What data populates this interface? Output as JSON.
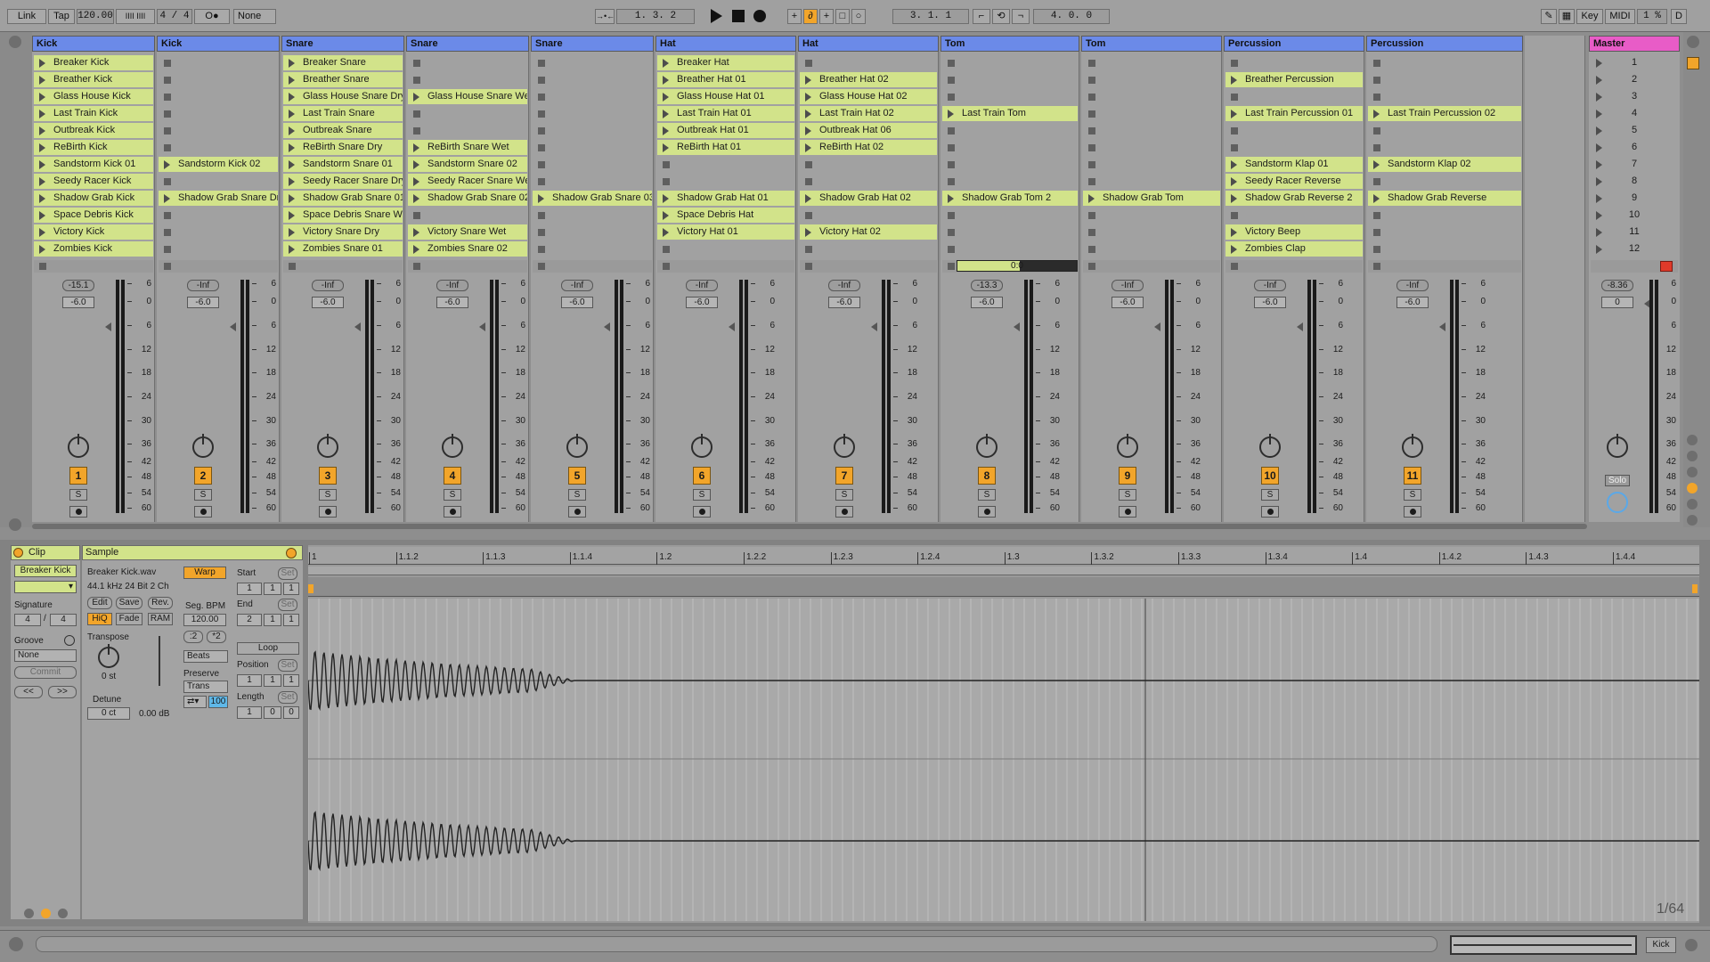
{
  "toolbar": {
    "link": "Link",
    "tap": "Tap",
    "tempo": "120.00",
    "bars_icons": "IIII IIII",
    "signature": "4 / 4",
    "metronome": "O●",
    "quantize": "None",
    "follow": "→•←",
    "position": "1.   3.   2",
    "loop_start": "3.   1.   1",
    "loop_length": "4.   0.   0",
    "key": "Key",
    "midi": "MIDI",
    "cpu": "1 %",
    "disk": "D"
  },
  "tracks": [
    {
      "name": "Kick",
      "color": "#6b8ae8",
      "number": "1",
      "vol": "-15.1",
      "set": "-6.0",
      "clips": [
        "Breaker Kick",
        "Breather Kick",
        "Glass House Kick",
        "Last Train Kick",
        "Outbreak Kick",
        "ReBirth Kick",
        "Sandstorm Kick 01",
        "Seedy Racer Kick",
        "Shadow Grab Kick",
        "Space Debris Kick",
        "Victory Kick",
        "Zombies Kick"
      ]
    },
    {
      "name": "Kick",
      "color": "#6b8ae8",
      "number": "2",
      "vol": "-Inf",
      "set": "-6.0",
      "clips": [
        "",
        "",
        "",
        "",
        "",
        "",
        "Sandstorm Kick 02",
        "",
        "Shadow Grab Snare Dry",
        "",
        "",
        ""
      ]
    },
    {
      "name": "Snare",
      "color": "#6b8ae8",
      "number": "3",
      "vol": "-Inf",
      "set": "-6.0",
      "clips": [
        "Breaker Snare",
        "Breather Snare",
        "Glass House Snare Dry",
        "Last Train Snare",
        "Outbreak Snare",
        "ReBirth Snare Dry",
        "Sandstorm Snare 01",
        "Seedy Racer Snare Dry",
        "Shadow Grab Snare 01",
        "Space Debris Snare We",
        "Victory Snare Dry",
        "Zombies Snare 01"
      ]
    },
    {
      "name": "Snare",
      "color": "#6b8ae8",
      "number": "4",
      "vol": "-Inf",
      "set": "-6.0",
      "clips": [
        "",
        "",
        "Glass House Snare Wet",
        "",
        "",
        "ReBirth Snare Wet",
        "Sandstorm Snare 02",
        "Seedy Racer Snare Wet",
        "Shadow Grab Snare 02",
        "",
        "Victory Snare Wet",
        "Zombies Snare 02"
      ]
    },
    {
      "name": "Snare",
      "color": "#6b8ae8",
      "number": "5",
      "vol": "-Inf",
      "set": "-6.0",
      "clips": [
        "",
        "",
        "",
        "",
        "",
        "",
        "",
        "",
        "Shadow Grab Snare 03",
        "",
        "",
        ""
      ]
    },
    {
      "name": "Hat",
      "color": "#6b8ae8",
      "number": "6",
      "vol": "-Inf",
      "set": "-6.0",
      "clips": [
        "Breaker Hat",
        "Breather Hat 01",
        "Glass House Hat 01",
        "Last Train Hat 01",
        "Outbreak Hat 01",
        "ReBirth Hat 01",
        "",
        "",
        "Shadow Grab Hat 01",
        "Space Debris Hat",
        "Victory Hat 01",
        ""
      ]
    },
    {
      "name": "Hat",
      "color": "#6b8ae8",
      "number": "7",
      "vol": "-Inf",
      "set": "-6.0",
      "clips": [
        "",
        "Breather Hat 02",
        "Glass House Hat 02",
        "Last Train Hat 02",
        "Outbreak Hat 06",
        "ReBirth Hat 02",
        "",
        "",
        "Shadow Grab Hat 02",
        "",
        "Victory Hat 02",
        ""
      ]
    },
    {
      "name": "Tom",
      "color": "#6b8ae8",
      "number": "8",
      "vol": "-13.3",
      "set": "-6.0",
      "clips": [
        "",
        "",
        "",
        "Last Train Tom",
        "",
        "",
        "",
        "",
        "Shadow Grab Tom 2",
        "",
        "",
        ""
      ]
    },
    {
      "name": "Tom",
      "color": "#6b8ae8",
      "number": "9",
      "vol": "-Inf",
      "set": "-6.0",
      "clips": [
        "",
        "",
        "",
        "",
        "",
        "",
        "",
        "",
        "Shadow Grab Tom",
        "",
        "",
        ""
      ]
    },
    {
      "name": "Percussion",
      "color": "#6b8ae8",
      "number": "10",
      "vol": "-Inf",
      "set": "-6.0",
      "clips": [
        "",
        "Breather Percussion",
        "",
        "Last Train Percussion 01",
        "",
        "",
        "Sandstorm Klap 01",
        "Seedy Racer Reverse",
        "Shadow Grab Reverse 2",
        "",
        "Victory Beep",
        "Zombies Clap"
      ]
    },
    {
      "name": "Percussion",
      "color": "#6b8ae8",
      "number": "11",
      "vol": "-Inf",
      "set": "-6.0",
      "clips": [
        "",
        "",
        "",
        "Last Train Percussion 02",
        "",
        "",
        "Sandstorm Klap 02",
        "",
        "Shadow Grab Reverse",
        "",
        "",
        ""
      ]
    }
  ],
  "master": {
    "name": "Master",
    "color": "#e85cc7",
    "vol": "-8.36",
    "set": "0",
    "scenes": [
      "1",
      "2",
      "3",
      "4",
      "5",
      "6",
      "7",
      "8",
      "9",
      "10",
      "11",
      "12"
    ],
    "solo": "Solo"
  },
  "tom_progress": "0:0",
  "db_scale": [
    "6",
    "0",
    "6",
    "12",
    "18",
    "24",
    "30",
    "36",
    "42",
    "48",
    "54",
    "60"
  ],
  "clip_view": {
    "clip_title": "Clip",
    "clip_name": "Breaker Kick",
    "signature_label": "Signature",
    "sig_num": "4",
    "sig_den": "4",
    "groove_label": "Groove",
    "groove_value": "None",
    "commit": "Commit",
    "nav_prev": "<<",
    "nav_next": ">>",
    "sample_title": "Sample",
    "file": "Breaker Kick.wav",
    "format": "44.1 kHz 24 Bit 2 Ch",
    "warp": "Warp",
    "edit": "Edit",
    "save": "Save",
    "rev": "Rev.",
    "hiq": "HiQ",
    "fade": "Fade",
    "ram": "RAM",
    "seg_bpm_label": "Seg. BPM",
    "seg_bpm": "120.00",
    "half": ":2",
    "double": "*2",
    "warp_mode": "Beats",
    "preserve_label": "Preserve",
    "preserve_value": "Trans",
    "transient_value": "100",
    "transpose_label": "Transpose",
    "transpose_value": "0 st",
    "detune_label": "Detune",
    "detune_value": "0 ct",
    "gain_value": "0.00 dB",
    "start_label": "Start",
    "end_label": "End",
    "set_label": "Set",
    "loop": "Loop",
    "position_label": "Position",
    "length_label": "Length",
    "start_vals": [
      "1",
      "1",
      "1"
    ],
    "end_vals": [
      "2",
      "1",
      "1"
    ],
    "position_vals": [
      "1",
      "1",
      "1"
    ],
    "length_vals": [
      "1",
      "0",
      "0"
    ],
    "zoom": "1/64"
  },
  "ruler": [
    "1",
    "1.1.2",
    "1.1.3",
    "1.1.4",
    "1.2",
    "1.2.2",
    "1.2.3",
    "1.2.4",
    "1.3",
    "1.3.2",
    "1.3.3",
    "1.3.4",
    "1.4",
    "1.4.2",
    "1.4.3",
    "1.4.4"
  ],
  "status": {
    "track": "Kick"
  }
}
